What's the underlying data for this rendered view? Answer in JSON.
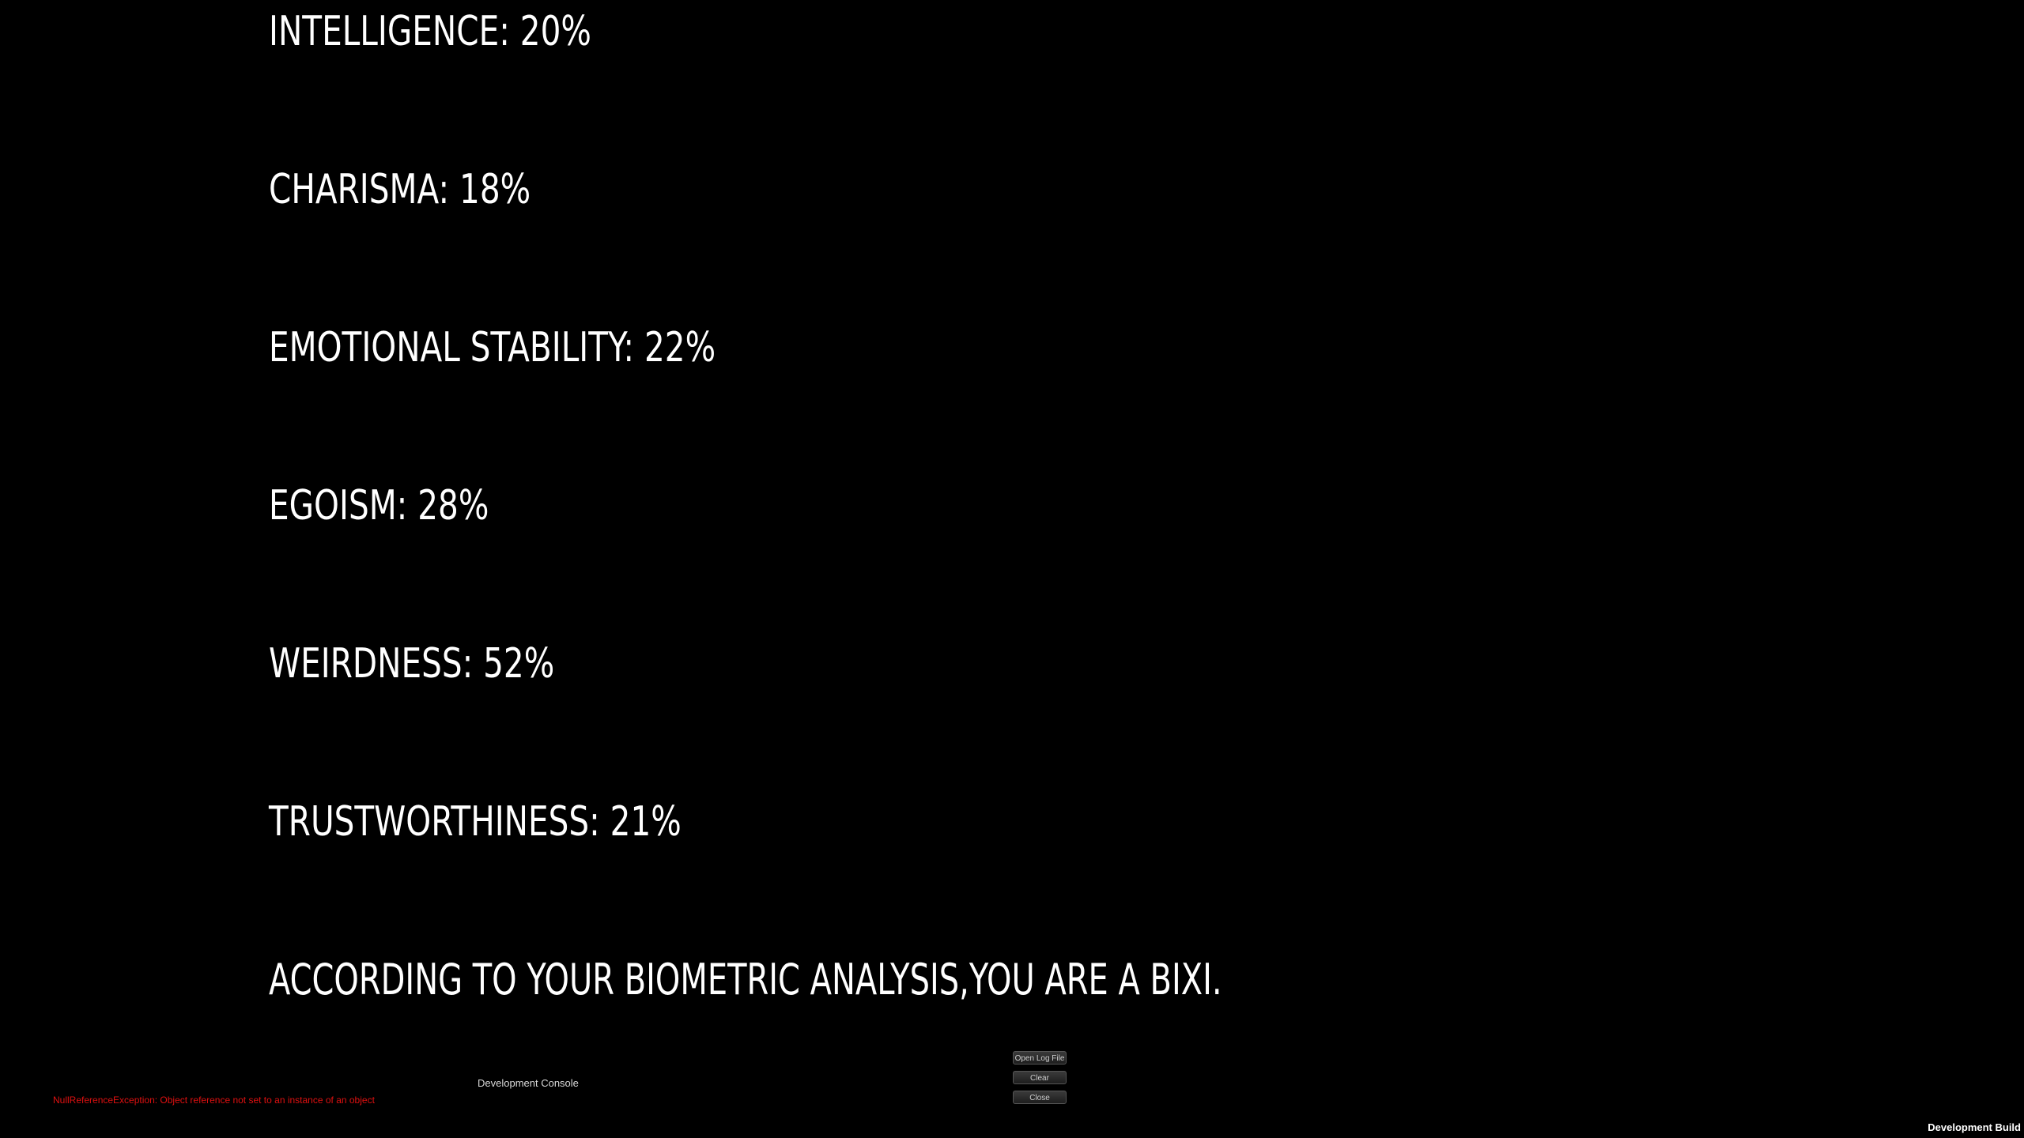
{
  "stats": [
    {
      "label": "INTELLIGENCE: 20%"
    },
    {
      "label": "CHARISMA: 18%"
    },
    {
      "label": "EMOTIONAL STABILITY: 22%"
    },
    {
      "label": "EGOISM: 28%"
    },
    {
      "label": "WEIRDNESS: 52%"
    },
    {
      "label": "TRUSTWORTHINESS: 21%"
    }
  ],
  "result": "ACCORDING TO YOUR BIOMETRIC ANALYSIS,YOU ARE A BIXI.",
  "console": {
    "title": "Development Console",
    "error": "NullReferenceException: Object reference not set to an instance of an object",
    "buttons": {
      "open_log": "Open Log File",
      "clear": "Clear",
      "close": "Close"
    }
  },
  "build_label": "Development Build",
  "colors": {
    "background": "#000000",
    "text": "#ffffff",
    "error": "#e01010"
  }
}
